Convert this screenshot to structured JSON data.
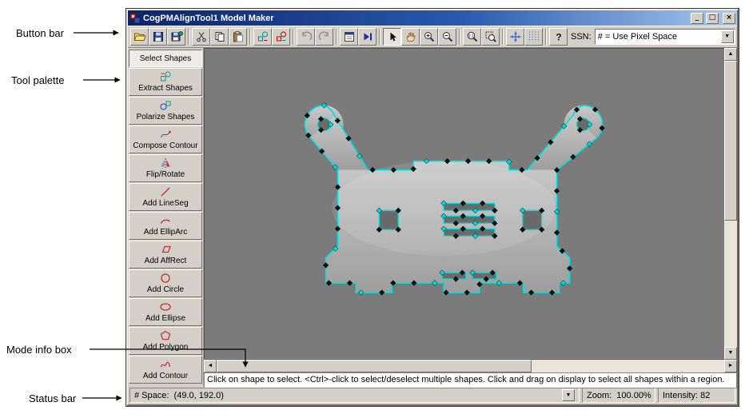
{
  "annotations": {
    "button_bar": "Button bar",
    "tool_palette": "Tool palette",
    "mode_info_box": "Mode info box",
    "status_bar": "Status bar"
  },
  "window": {
    "title": "CogPMAlignTool1 Model Maker",
    "minimize_glyph": "_",
    "maximize_glyph": "□",
    "close_glyph": "×"
  },
  "toolbar": {
    "ssn_label": "SSN:",
    "ssn_value": "# = Use Pixel Space",
    "dropdown_glyph": "▼",
    "button_icons": [
      "open",
      "save",
      "save-image",
      "cut",
      "copy",
      "paste",
      "shapes-teal",
      "shapes-red",
      "undo",
      "redo",
      "properties",
      "run-once",
      "select-pointer",
      "pan",
      "zoom-in",
      "zoom-out",
      "zoom-actual",
      "zoom-fit",
      "grid-crosshair",
      "grid-dots",
      "help"
    ]
  },
  "palette": {
    "items": [
      {
        "label": "Select Shapes"
      },
      {
        "label": "Extract Shapes"
      },
      {
        "label": "Polarize Shapes"
      },
      {
        "label": "Compose Contour"
      },
      {
        "label": "Flip/Rotate"
      },
      {
        "label": "Add LineSeg"
      },
      {
        "label": "Add EllipArc"
      },
      {
        "label": "Add AffRect"
      },
      {
        "label": "Add Circle"
      },
      {
        "label": "Add Ellipse"
      },
      {
        "label": "Add Polygon"
      },
      {
        "label": "Add Contour"
      }
    ]
  },
  "display": {
    "contour_color": "#00e0e0",
    "background_color": "#7b7b7b",
    "part_color": "#b9b9b9"
  },
  "scroll": {
    "up_glyph": "▲",
    "down_glyph": "▼",
    "left_glyph": "◄",
    "right_glyph": "►"
  },
  "mode_info": "Click on shape to select. <Ctrl>-click to select/deselect multiple shapes. Click and drag on display to select all shapes within a region.",
  "status": {
    "space": "# Space:  (49.0, 192.0)",
    "zoom": "Zoom:  100.00%",
    "intensity": "Intensity: 82",
    "dropdown_glyph": "▼"
  }
}
